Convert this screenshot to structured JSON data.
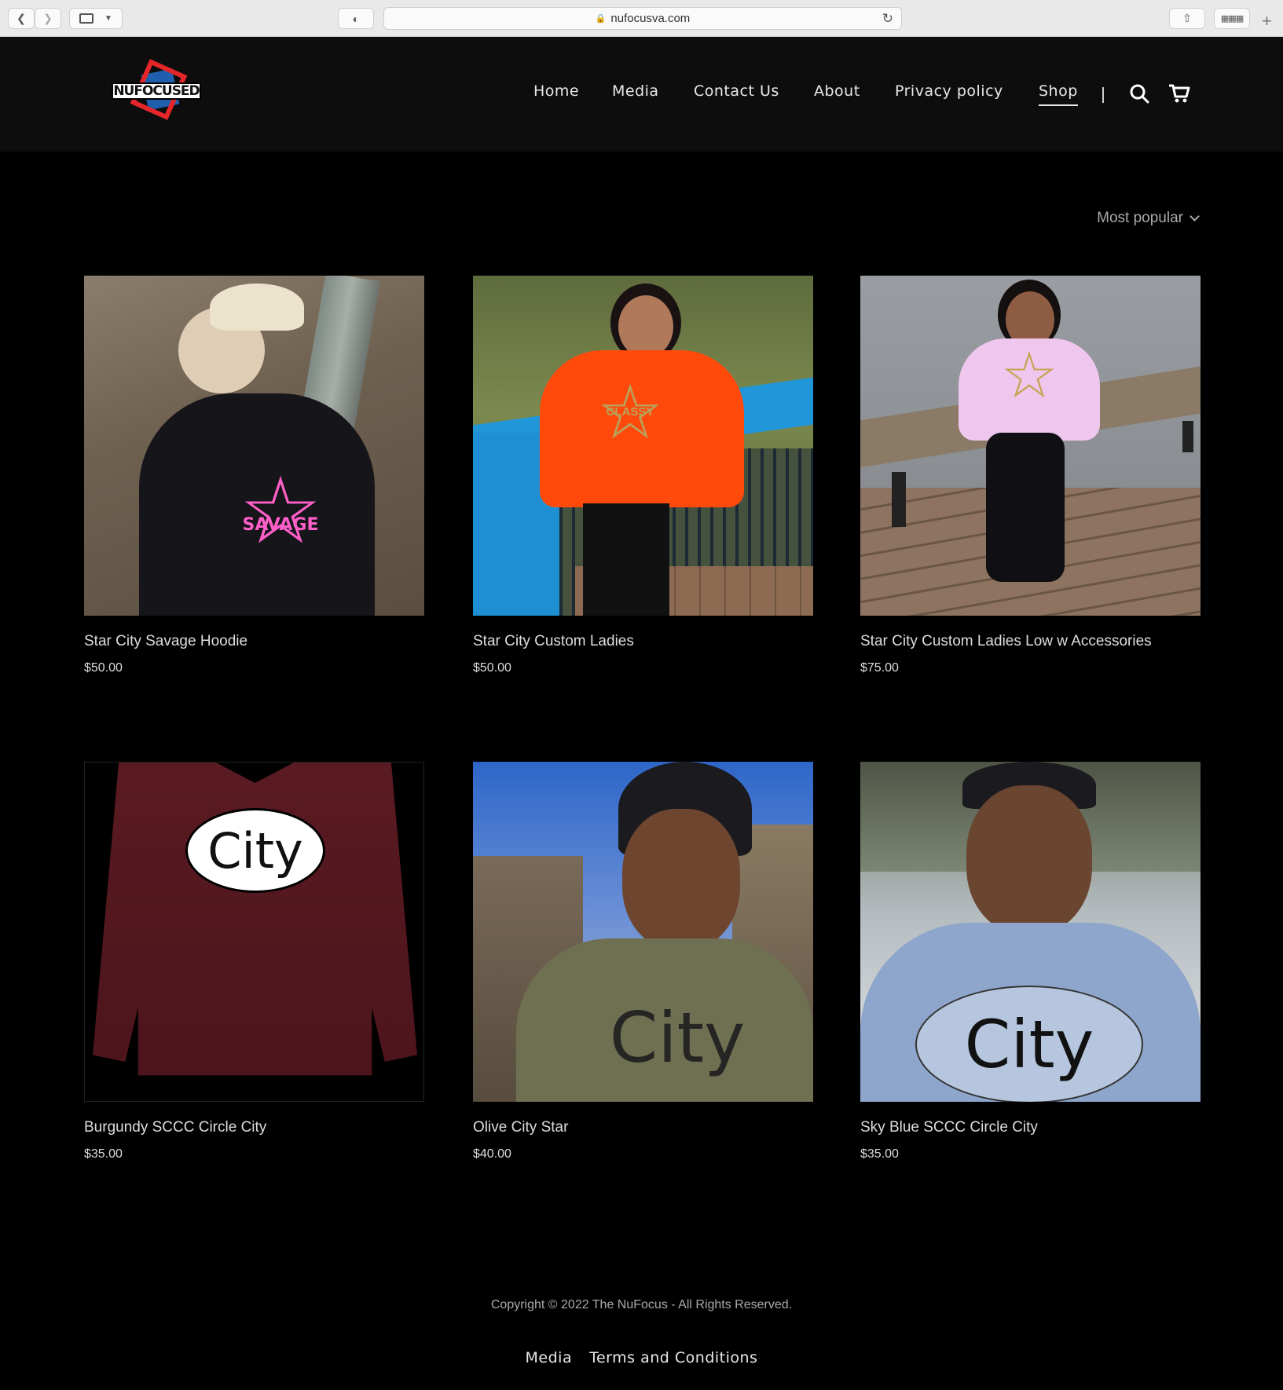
{
  "browser": {
    "url": "nufocusva.com"
  },
  "header": {
    "logo_text": "NUFOCUSED",
    "nav": [
      {
        "label": "Home"
      },
      {
        "label": "Media"
      },
      {
        "label": "Contact Us"
      },
      {
        "label": "About"
      },
      {
        "label": "Privacy policy"
      },
      {
        "label": "Shop",
        "active": true
      }
    ],
    "icons": [
      "search-icon",
      "cart-icon"
    ]
  },
  "sort": {
    "label": "Most popular"
  },
  "products": [
    {
      "title": "Star City Savage Hoodie",
      "price": "$50.00",
      "graphic": "SAVAGE"
    },
    {
      "title": "Star City Custom Ladies",
      "price": "$50.00",
      "graphic": "CLASSY"
    },
    {
      "title": "Star City Custom Ladies Low w Accessories",
      "price": "$75.00",
      "graphic": ""
    },
    {
      "title": "Burgundy SCCC Circle City",
      "price": "$35.00",
      "graphic": "City"
    },
    {
      "title": "Olive City Star",
      "price": "$40.00",
      "graphic": "City"
    },
    {
      "title": "Sky Blue SCCC Circle City",
      "price": "$35.00",
      "graphic": "City"
    }
  ],
  "footer": {
    "copyright": "Copyright © 2022 The NuFocus - All Rights Reserved.",
    "links": [
      {
        "label": "Media"
      },
      {
        "label": "Terms and Conditions"
      }
    ]
  }
}
